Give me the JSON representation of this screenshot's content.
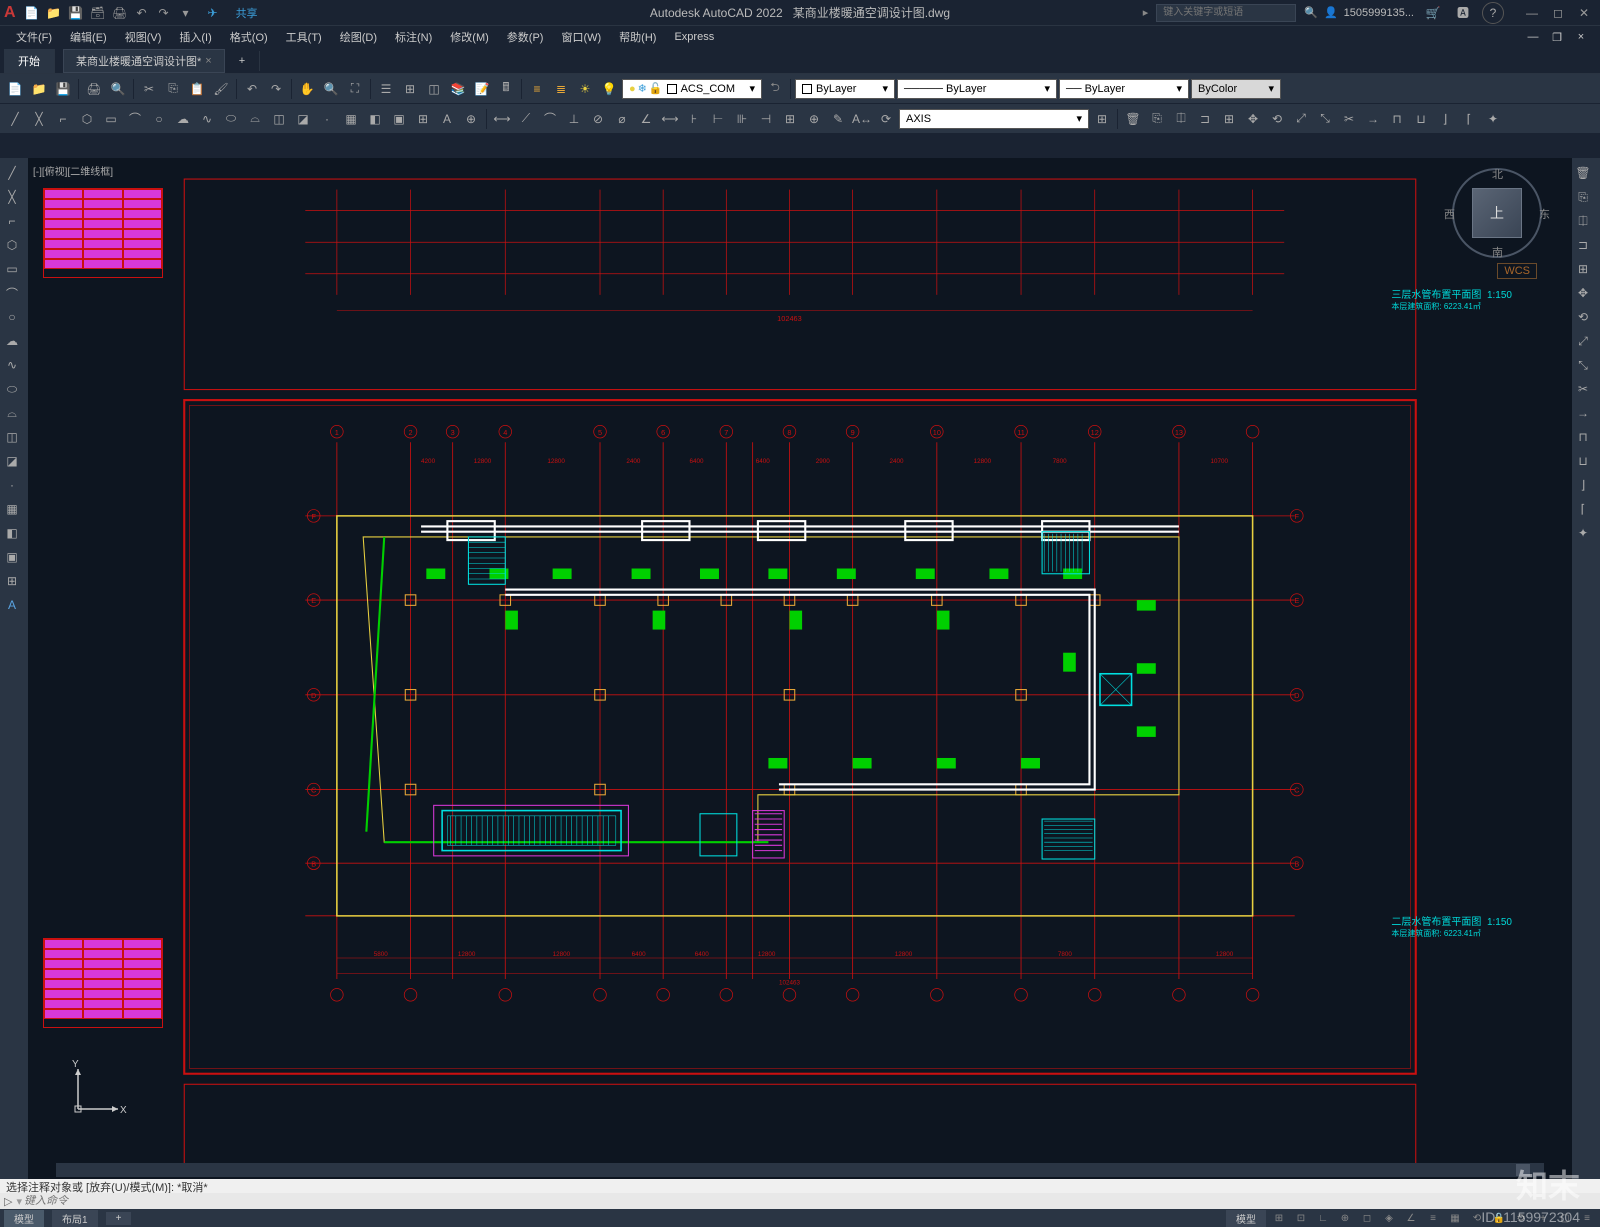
{
  "title": {
    "app": "Autodesk AutoCAD 2022",
    "file": "某商业楼暖通空调设计图.dwg"
  },
  "share": "共享",
  "search_placeholder": "键入关键字或短语",
  "user": "1505999135...",
  "menu": {
    "file": "文件(F)",
    "edit": "编辑(E)",
    "view": "视图(V)",
    "insert": "插入(I)",
    "format": "格式(O)",
    "tools": "工具(T)",
    "draw": "绘图(D)",
    "dimension": "标注(N)",
    "modify": "修改(M)",
    "param": "参数(P)",
    "window": "窗口(W)",
    "help": "帮助(H)",
    "express": "Express"
  },
  "ribbon_tab": "开始",
  "doc_tab": "某商业楼暖通空调设计图*",
  "doc_add": "+",
  "layer": {
    "current": "ACS_COM"
  },
  "props": {
    "layer": "ByLayer",
    "linetype": "ByLayer",
    "lineweight": "ByLayer",
    "color": "ByColor"
  },
  "dimstyle": "AXIS",
  "viewcube": {
    "top": "上",
    "n": "北",
    "s": "南",
    "e": "东",
    "w": "西"
  },
  "wcs": "WCS",
  "ucs": {
    "x": "X",
    "y": "Y"
  },
  "viewport_label": "[-][俯视][二维线框]",
  "drawing_titles": {
    "upper": "三层水管布置平面图",
    "upper_scale": "1:150",
    "upper_area": "本层建筑面积: 6223.41㎡",
    "lower": "二层水管布置平面图",
    "lower_scale": "1:150",
    "lower_area": "本层建筑面积: 6223.41㎡"
  },
  "grid_axes_h": [
    "1",
    "2",
    "3",
    "4",
    "5",
    "6",
    "7",
    "8",
    "9",
    "10",
    "11",
    "12",
    "13"
  ],
  "grid_axes_v": [
    "F",
    "E",
    "D",
    "C",
    "B"
  ],
  "dimensions_top": [
    "4200",
    "12800",
    "12800",
    "2400",
    "6400",
    "6400",
    "2900",
    "2400",
    "12800",
    "7800",
    "10700"
  ],
  "dimensions_total": "102463",
  "cmd": {
    "history": "选择注释对象或 [放弃(U)/模式(M)]:  *取消*",
    "prompt_icon": "▷",
    "placeholder": "键入命令"
  },
  "status": {
    "model": "模型",
    "layout1": "布局1",
    "plus": "+",
    "model_btn": "模型"
  },
  "watermark": "知末",
  "watermark_id": "ID: 1159972304",
  "icons": {
    "new": "📄",
    "open": "📁",
    "save": "💾",
    "saveall": "🗃",
    "print": "🖨",
    "undo": "↶",
    "redo": "↷",
    "send": "✈",
    "line": "╱",
    "polyline": "⌐",
    "circle": "○",
    "arc": "⌒",
    "rect": "▭",
    "ellipse": "⬭",
    "spline": "∿",
    "point": "·",
    "move": "✥",
    "copy": "⎘",
    "rotate": "⟲",
    "mirror": "⎅",
    "scale": "⤢",
    "trim": "✂",
    "extend": "→",
    "fillet": "⌈",
    "text": "A",
    "mtext": "A",
    "hatch": "▦",
    "dim": "⟷",
    "table": "⊞",
    "block": "◫",
    "layer": "≡",
    "props": "☰",
    "pan": "✋",
    "zoom": "🔍",
    "zoomext": "⛶",
    "3dorbit": "⭯",
    "mline": "═",
    "sun": "☀",
    "bulb": "💡",
    "freeze": "❄",
    "lock": "🔒",
    "color": "□",
    "plus": "+",
    "x": "×",
    "min": "—",
    "max": "◻",
    "close": "✕",
    "cart": "🛒",
    "help": "?",
    "user": "👤",
    "down": "▾",
    "search": "🔍",
    "gear": "⚙",
    "grid": "⊞",
    "snap": "⊡",
    "ortho": "∟"
  }
}
